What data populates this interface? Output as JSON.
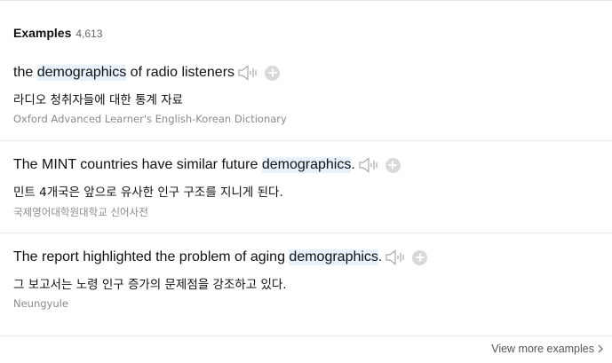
{
  "header": {
    "title": "Examples",
    "count": "4,613"
  },
  "examples": [
    {
      "parts": [
        "the ",
        "demographics",
        " of radio listeners"
      ],
      "translation": "라디오 청취자들에 대한 통계 자료",
      "source": "Oxford Advanced Learner's English-Korean Dictionary"
    },
    {
      "parts": [
        "The MINT countries have similar future ",
        "demographics",
        "."
      ],
      "translation": "민트 4개국은 앞으로 유사한 인구 구조를 지니게 된다.",
      "source": "국제영어대학원대학교 신어사전"
    },
    {
      "parts": [
        "The report highlighted the problem of aging ",
        "demographics",
        "."
      ],
      "translation": "그 보고서는 노령 인구 증가의 문제점을 강조하고 있다.",
      "source": "Neungyule"
    }
  ],
  "footer": {
    "view_more_label": "View more examples"
  },
  "icons": {
    "audio": "speaker-icon",
    "add": "plus-circle-icon",
    "more": "chevron-right-icon"
  },
  "colors": {
    "highlight": "#e8f2fd",
    "icon_gray": "#aaaaaa",
    "source_gray": "#8a8a8a"
  }
}
